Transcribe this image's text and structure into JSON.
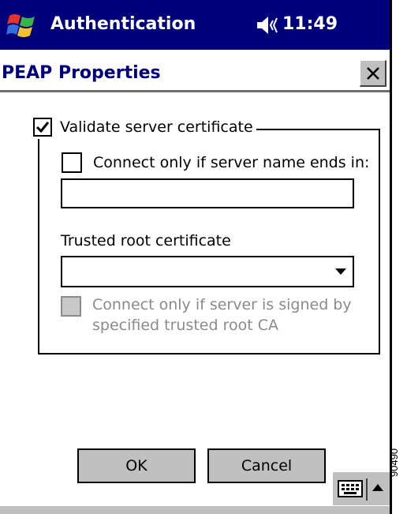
{
  "nav": {
    "start_icon": "windows-flag-icon",
    "app_title": "Authentication",
    "speaker_icon": "speaker-icon",
    "time": "11:49"
  },
  "dialog": {
    "title": "PEAP Properties",
    "close_icon": "close-icon",
    "validate_label": "Validate server certificate",
    "validate_checked": true,
    "connect_name_label": "Connect only if server name ends in:",
    "connect_name_checked": false,
    "server_name_value": "",
    "trusted_root_label": "Trusted root certificate",
    "trusted_root_value": "",
    "signed_label_line1": "Connect only if server is signed by",
    "signed_label_line2": "specified trusted root CA",
    "signed_checked": false,
    "ok_label": "OK",
    "cancel_label": "Cancel"
  },
  "taskbar": {
    "keyboard_icon": "keyboard-icon",
    "up_arrow_icon": "up-arrow-icon"
  },
  "figure_id": "90490"
}
